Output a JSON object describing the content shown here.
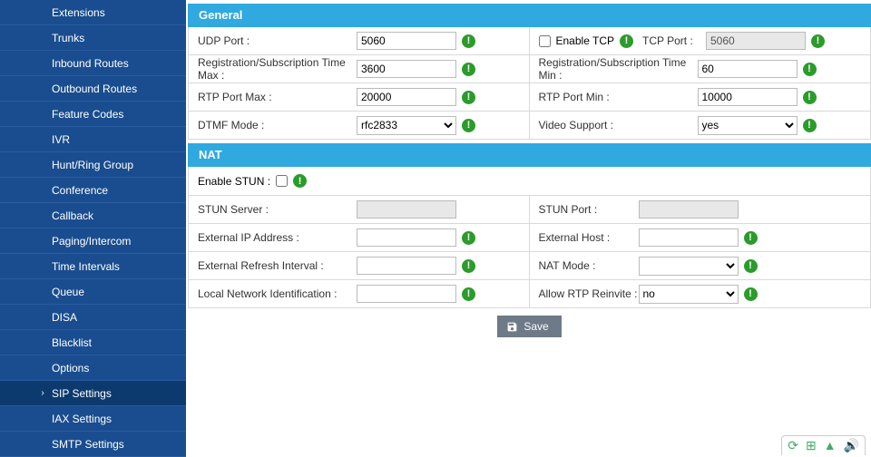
{
  "sidebar": {
    "items": [
      {
        "label": "Extensions"
      },
      {
        "label": "Trunks"
      },
      {
        "label": "Inbound Routes"
      },
      {
        "label": "Outbound Routes"
      },
      {
        "label": "Feature Codes"
      },
      {
        "label": "IVR"
      },
      {
        "label": "Hunt/Ring Group"
      },
      {
        "label": "Conference"
      },
      {
        "label": "Callback"
      },
      {
        "label": "Paging/Intercom"
      },
      {
        "label": "Time Intervals"
      },
      {
        "label": "Queue"
      },
      {
        "label": "DISA"
      },
      {
        "label": "Blacklist"
      },
      {
        "label": "Options"
      },
      {
        "label": "SIP Settings",
        "active": true
      },
      {
        "label": "IAX Settings"
      },
      {
        "label": "SMTP Settings"
      }
    ]
  },
  "sections": {
    "general": {
      "title": "General",
      "udp_port_label": "UDP Port :",
      "udp_port_value": "5060",
      "enable_tcp_label": "Enable TCP",
      "tcp_port_label": "TCP Port :",
      "tcp_port_value": "5060",
      "reg_max_label": "Registration/Subscription Time Max :",
      "reg_max_value": "3600",
      "reg_min_label": "Registration/Subscription Time Min :",
      "reg_min_value": "60",
      "rtp_max_label": "RTP Port Max :",
      "rtp_max_value": "20000",
      "rtp_min_label": "RTP Port Min :",
      "rtp_min_value": "10000",
      "dtmf_label": "DTMF Mode :",
      "dtmf_value": "rfc2833",
      "video_label": "Video Support :",
      "video_value": "yes"
    },
    "nat": {
      "title": "NAT",
      "enable_stun_label": "Enable STUN :",
      "stun_server_label": "STUN Server :",
      "stun_server_value": "",
      "stun_port_label": "STUN Port :",
      "stun_port_value": "",
      "ext_ip_label": "External IP Address :",
      "ext_ip_value": "",
      "ext_host_label": "External Host :",
      "ext_host_value": "",
      "ext_refresh_label": "External Refresh Interval :",
      "ext_refresh_value": "",
      "nat_mode_label": "NAT Mode :",
      "nat_mode_value": "",
      "local_net_label": "Local Network Identification :",
      "local_net_value": "",
      "allow_rtp_label": "Allow RTP Reinvite :",
      "allow_rtp_value": "no"
    }
  },
  "buttons": {
    "save": "Save"
  }
}
